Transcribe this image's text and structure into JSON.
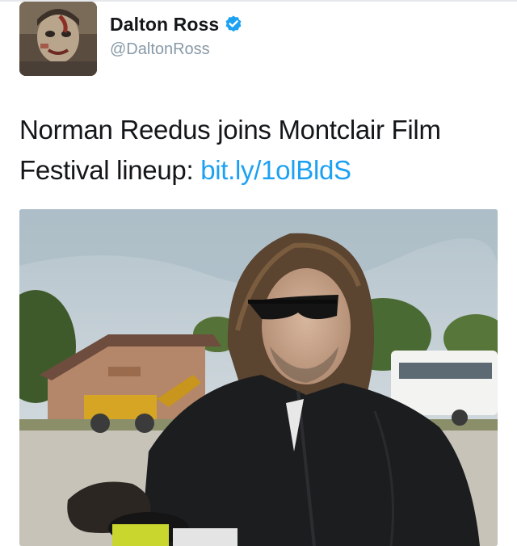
{
  "tweet": {
    "author": {
      "display_name": "Dalton Ross",
      "handle": "@DaltonRoss",
      "verified_icon": "verified-badge-icon"
    },
    "text_before_link": "Norman Reedus joins Montclair Film Festival lineup: ",
    "link_text": "bit.ly/1olBldS"
  },
  "colors": {
    "link": "#1da1f2",
    "name": "#14171a",
    "handle": "#8899a6",
    "verified": "#1da1f2"
  }
}
